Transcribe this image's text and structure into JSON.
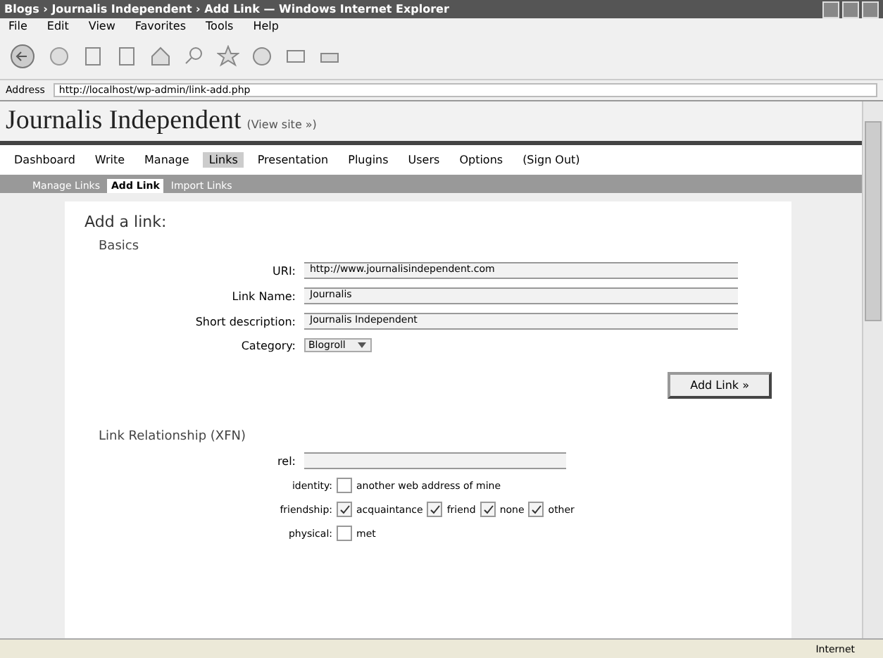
{
  "window": {
    "title": "Blogs › Journalis Independent › Add Link — Windows Internet Explorer"
  },
  "menu": [
    "File",
    "Edit",
    "View",
    "Favorites",
    "Tools",
    "Help"
  ],
  "address": {
    "label": "Address",
    "value": "http://localhost/wp-admin/link-add.php"
  },
  "site": {
    "title": "Journalis Independent",
    "subtitle": "(View site »)"
  },
  "nav": [
    {
      "label": "Dashboard",
      "selected": false
    },
    {
      "label": "Write",
      "selected": false
    },
    {
      "label": "Manage",
      "selected": false
    },
    {
      "label": "Links",
      "selected": true
    },
    {
      "label": "Presentation",
      "selected": false
    },
    {
      "label": "Plugins",
      "selected": false
    },
    {
      "label": "Users",
      "selected": false
    },
    {
      "label": "Options",
      "selected": false
    },
    {
      "label": "(Sign Out)",
      "selected": false
    }
  ],
  "subnav": [
    {
      "label": "Manage Links",
      "selected": false
    },
    {
      "label": "Add Link",
      "selected": true
    },
    {
      "label": "Import Links",
      "selected": false
    }
  ],
  "form": {
    "heading": "Add a link:",
    "section": "Basics",
    "fields": [
      {
        "label": "URI:",
        "value": "http://www.journalisindependent.com"
      },
      {
        "label": "Link Name:",
        "value": "Journalis"
      },
      {
        "label": "Short description:",
        "value": "Journalis Independent"
      }
    ],
    "category": {
      "label": "Category:",
      "value": "Blogroll"
    },
    "submit": "Add Link »"
  },
  "xfn": {
    "heading": "Link Relationship (XFN)",
    "rel_label": "rel:",
    "rows": [
      {
        "label": "identity:",
        "options": [
          {
            "label": "another web address of mine",
            "checked": false
          }
        ]
      },
      {
        "label": "friendship:",
        "options": [
          {
            "label": "acquaintance",
            "checked": true
          },
          {
            "label": "friend",
            "checked": true
          },
          {
            "label": "none",
            "checked": true
          },
          {
            "label": "other",
            "checked": true
          }
        ]
      },
      {
        "label": "physical:",
        "options": [
          {
            "label": "met",
            "checked": false
          }
        ]
      }
    ]
  },
  "status_bar": {
    "zone": "Internet"
  }
}
